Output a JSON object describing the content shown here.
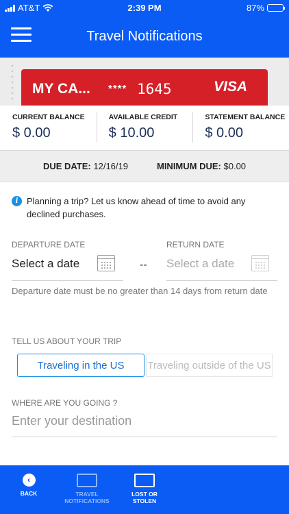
{
  "status_bar": {
    "carrier": "AT&T",
    "time": "2:39 PM",
    "battery": "87%",
    "battery_level": 0.87
  },
  "header": {
    "title": "Travel Notifications"
  },
  "card": {
    "name": "MY CA...",
    "mask": "****",
    "last4": "1645",
    "brand": "VISA"
  },
  "balances": [
    {
      "label": "CURRENT BALANCE",
      "value": "$ 0.00"
    },
    {
      "label": "AVAILABLE CREDIT",
      "value": "$ 10.00"
    },
    {
      "label": "STATEMENT BALANCE",
      "value": "$ 0.00"
    }
  ],
  "due": {
    "due_label": "DUE DATE:",
    "due_value": "12/16/19",
    "min_label": "MINIMUM DUE:",
    "min_value": "$0.00"
  },
  "info": {
    "text": "Planning a trip? Let us know ahead of time to avoid any declined purchases."
  },
  "dates": {
    "departure_label": "DEPARTURE DATE",
    "departure_value": "Select a date",
    "separator": "--",
    "return_label": "RETURN DATE",
    "return_value": "Select a date",
    "hint": "Departure date must be no greater than 14 days from return date"
  },
  "trip": {
    "label": "TELL US ABOUT YOUR TRIP",
    "options": [
      "Traveling in the US",
      "Traveling outside of the US"
    ],
    "selected": "Traveling in the US"
  },
  "destination": {
    "label": "WHERE ARE YOU GOING ?",
    "placeholder": "Enter your destination"
  },
  "nav": {
    "back": "BACK",
    "travel_line1": "TRAVEL",
    "travel_line2": "NOTIFICATIONS",
    "lost_line1": "LOST OR",
    "lost_line2": "STOLEN"
  },
  "colors": {
    "primary": "#0a5cf5",
    "card": "#d62028",
    "accent": "#1a8fe6"
  }
}
